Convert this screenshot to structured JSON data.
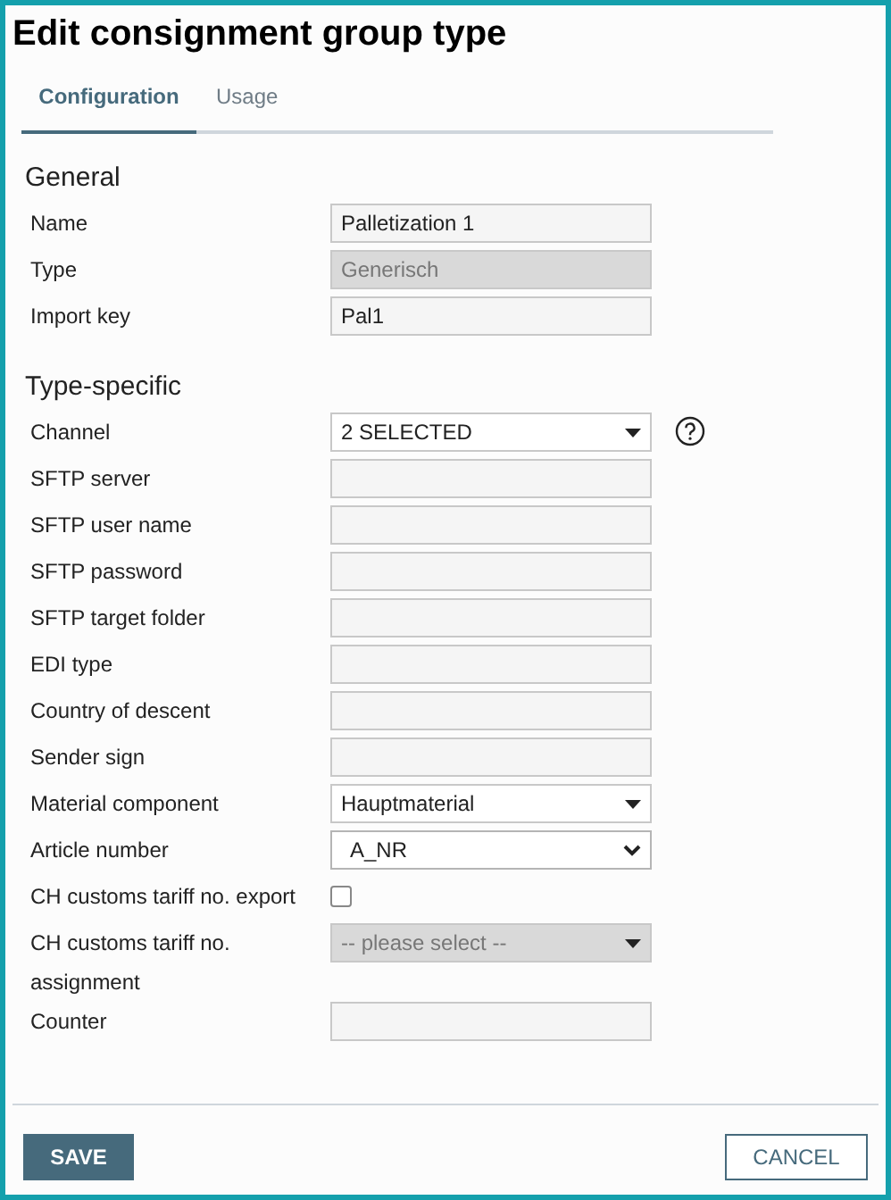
{
  "window": {
    "title": "Edit consignment group type"
  },
  "tabs": [
    {
      "label": "Configuration",
      "selected": true
    },
    {
      "label": "Usage",
      "selected": false
    }
  ],
  "sections": [
    {
      "heading": "General",
      "rows": [
        {
          "label": "Name",
          "kind": "text",
          "value": "Palletization 1",
          "disabled": false
        },
        {
          "label": "Type",
          "kind": "text",
          "value": "Generisch",
          "disabled": true
        },
        {
          "label": "Import key",
          "kind": "text",
          "value": "Pal1",
          "disabled": false
        }
      ]
    },
    {
      "heading": "Type-specific",
      "rows": [
        {
          "label": "Channel",
          "kind": "dropdown",
          "value": "2 SELECTED",
          "disabled": false,
          "help": true
        },
        {
          "label": "SFTP server",
          "kind": "text",
          "disabled": false
        },
        {
          "label": "SFTP user name",
          "kind": "text",
          "disabled": false
        },
        {
          "label": "SFTP password",
          "kind": "text",
          "disabled": false
        },
        {
          "label": "SFTP target folder",
          "kind": "text",
          "disabled": false
        },
        {
          "label": "EDI type",
          "kind": "text",
          "disabled": false
        },
        {
          "label": "Country of descent",
          "kind": "text",
          "disabled": false
        },
        {
          "label": "Sender sign",
          "kind": "text",
          "disabled": false
        },
        {
          "label": "Material component",
          "kind": "dropdown",
          "value": "Hauptmaterial",
          "disabled": false
        },
        {
          "label": "Article number",
          "kind": "select",
          "value": "A_NR",
          "disabled": false
        },
        {
          "label": "CH customs tariff no. export",
          "kind": "checkbox",
          "checked": false
        },
        {
          "label": "CH customs tariff no. assignment",
          "kind": "dropdown",
          "placeholder": "-- please select --",
          "disabled": true
        },
        {
          "label": "Counter",
          "kind": "text",
          "disabled": false
        }
      ]
    }
  ],
  "buttons": {
    "save": "SAVE",
    "cancel": "CANCEL"
  }
}
